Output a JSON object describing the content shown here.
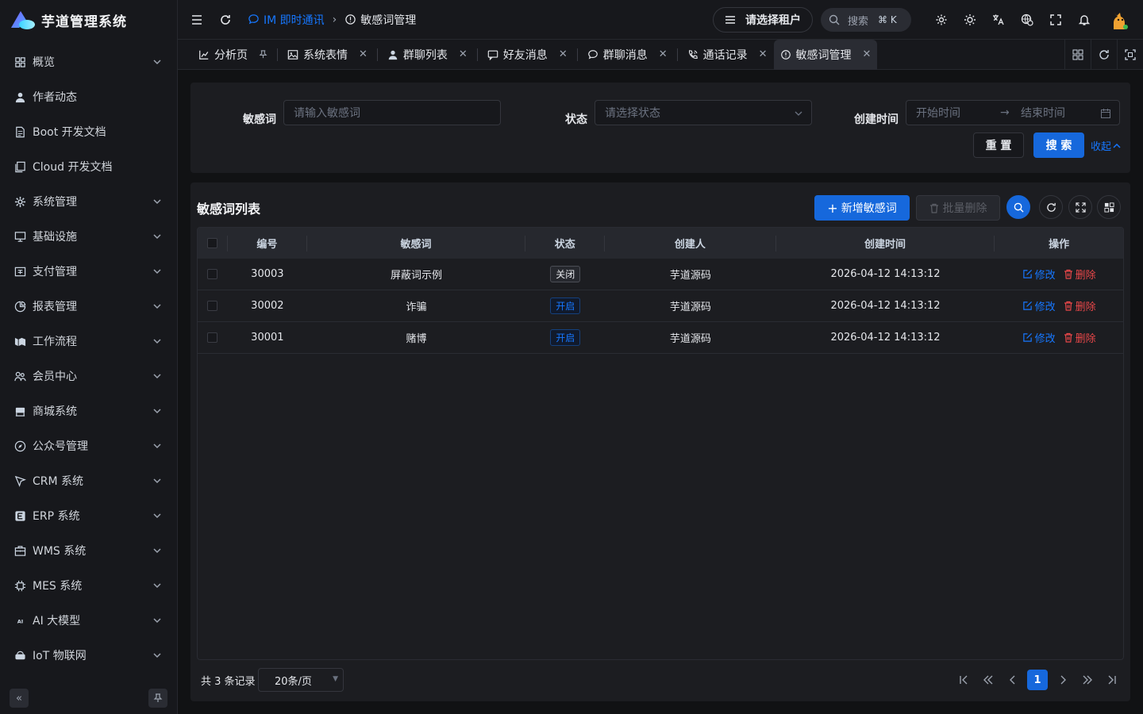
{
  "app": {
    "title": "芋道管理系统"
  },
  "sidebar": {
    "items": [
      {
        "label": "概览",
        "icon": "dashboard-icon",
        "expandable": true
      },
      {
        "label": "作者动态",
        "icon": "user-icon",
        "expandable": false
      },
      {
        "label": "Boot 开发文档",
        "icon": "document-icon",
        "expandable": false
      },
      {
        "label": "Cloud 开发文档",
        "icon": "copy-document-icon",
        "expandable": false
      },
      {
        "label": "系统管理",
        "icon": "gear-icon",
        "expandable": true
      },
      {
        "label": "基础设施",
        "icon": "monitor-icon",
        "expandable": true
      },
      {
        "label": "支付管理",
        "icon": "payment-icon",
        "expandable": true
      },
      {
        "label": "报表管理",
        "icon": "pie-chart-icon",
        "expandable": true
      },
      {
        "label": "工作流程",
        "icon": "workflow-icon",
        "expandable": true
      },
      {
        "label": "会员中心",
        "icon": "members-icon",
        "expandable": true
      },
      {
        "label": "商城系统",
        "icon": "store-icon",
        "expandable": true
      },
      {
        "label": "公众号管理",
        "icon": "compass-icon",
        "expandable": true
      },
      {
        "label": "CRM 系统",
        "icon": "crm-icon",
        "expandable": true
      },
      {
        "label": "ERP 系统",
        "icon": "erp-icon",
        "expandable": true
      },
      {
        "label": "WMS 系统",
        "icon": "briefcase-icon",
        "expandable": true
      },
      {
        "label": "MES 系统",
        "icon": "chip-icon",
        "expandable": true
      },
      {
        "label": "AI 大模型",
        "icon": "ai-icon",
        "expandable": true
      },
      {
        "label": "IoT 物联网",
        "icon": "iot-icon",
        "expandable": true
      }
    ]
  },
  "header": {
    "breadcrumb_parent": "IM 即时通讯",
    "breadcrumb_current": "敏感词管理",
    "tenant_label": "请选择租户",
    "search_label": "搜索",
    "search_shortcut": "⌘ K"
  },
  "tabs": [
    {
      "label": "分析页",
      "icon": "chart-icon",
      "closable": false
    },
    {
      "label": "系统表情",
      "icon": "image-icon",
      "closable": true
    },
    {
      "label": "群聊列表",
      "icon": "user-icon",
      "closable": true
    },
    {
      "label": "好友消息",
      "icon": "message-icon",
      "closable": true
    },
    {
      "label": "群聊消息",
      "icon": "chat-icon",
      "closable": true
    },
    {
      "label": "通话记录",
      "icon": "phone-icon",
      "closable": true
    },
    {
      "label": "敏感词管理",
      "icon": "info-icon",
      "closable": true,
      "active": true
    }
  ],
  "filter": {
    "word_label": "敏感词",
    "word_placeholder": "请输入敏感词",
    "status_label": "状态",
    "status_placeholder": "请选择状态",
    "time_label": "创建时间",
    "start_placeholder": "开始时间",
    "end_placeholder": "结束时间",
    "reset_label": "重 置",
    "search_label": "搜 索",
    "collapse_label": "收起"
  },
  "list": {
    "title": "敏感词列表",
    "add_label": "新增敏感词",
    "batch_delete_label": "批量删除",
    "columns": [
      "编号",
      "敏感词",
      "状态",
      "创建人",
      "创建时间",
      "操作"
    ],
    "rows": [
      {
        "id": "30003",
        "word": "屏蔽词示例",
        "status": "关闭",
        "status_on": false,
        "creator": "芋道源码",
        "created": "2026-04-12 14:13:12"
      },
      {
        "id": "30002",
        "word": "诈骗",
        "status": "开启",
        "status_on": true,
        "creator": "芋道源码",
        "created": "2026-04-12 14:13:12"
      },
      {
        "id": "30001",
        "word": "赌博",
        "status": "开启",
        "status_on": true,
        "creator": "芋道源码",
        "created": "2026-04-12 14:13:12"
      }
    ],
    "edit_label": "修改",
    "delete_label": "删除"
  },
  "pagination": {
    "total_text": "共 3 条记录",
    "page_size": "20条/页",
    "current_page": "1"
  },
  "colors": {
    "primary": "#1668dc",
    "link": "#1677ff",
    "danger": "#e84749"
  }
}
